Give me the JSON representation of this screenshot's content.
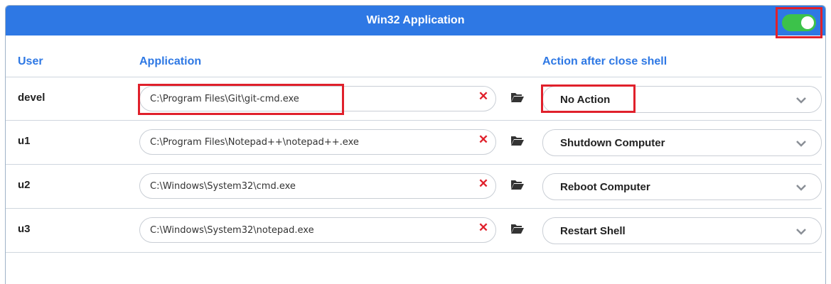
{
  "window": {
    "title": "Win32 Application"
  },
  "toggle": {
    "state": "on",
    "color": "#3cc24a"
  },
  "columns": {
    "user": "User",
    "application": "Application",
    "action": "Action after close shell"
  },
  "rows": [
    {
      "user": "devel",
      "application": "C:\\Program Files\\Git\\git-cmd.exe",
      "action": "No Action"
    },
    {
      "user": "u1",
      "application": "C:\\Program Files\\Notepad++\\notepad++.exe",
      "action": "Shutdown Computer"
    },
    {
      "user": "u2",
      "application": "C:\\Windows\\System32\\cmd.exe",
      "action": "Reboot Computer"
    },
    {
      "user": "u3",
      "application": "C:\\Windows\\System32\\notepad.exe",
      "action": "Restart Shell"
    }
  ],
  "icons": {
    "clear": "close-icon",
    "browse": "folder-open-icon",
    "dropdown": "chevron-down-icon"
  },
  "colors": {
    "accent": "#2e78e4",
    "highlight": "#e0202b",
    "clear": "#e0202b"
  }
}
